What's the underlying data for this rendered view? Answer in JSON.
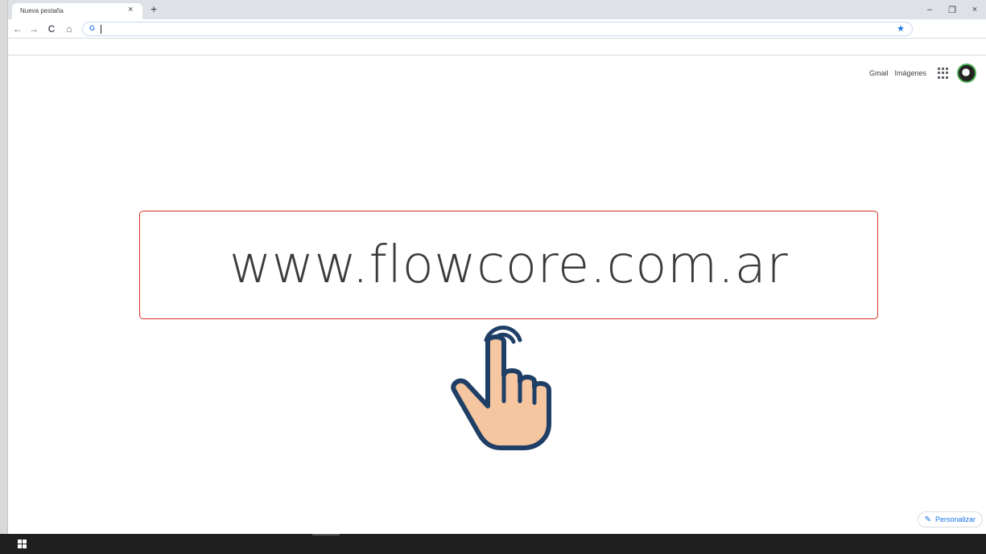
{
  "browser": {
    "tab_title": "Nueva pestaña",
    "tab_close": "×",
    "new_tab": "+",
    "window_controls": {
      "minimize": "–",
      "restore": "❐",
      "close": "×"
    },
    "nav": {
      "back": "←",
      "forward": "→",
      "reload": "C",
      "home": "⌂"
    },
    "omnibox": {
      "google_badge": "G",
      "value": "",
      "star": "★"
    }
  },
  "ntp": {
    "links": {
      "gmail": "Gmail",
      "images": "Imágenes"
    },
    "overlay_url": "www.flowcore.com.ar",
    "customize_label": "Personalizar",
    "customize_icon": "pencil-icon"
  },
  "colors": {
    "accent": "#1a73e8",
    "overlay_border": "#d93025",
    "hand_skin": "#f6c6a0",
    "hand_outline": "#1f3f66",
    "taskbar": "#1f1f1f"
  }
}
